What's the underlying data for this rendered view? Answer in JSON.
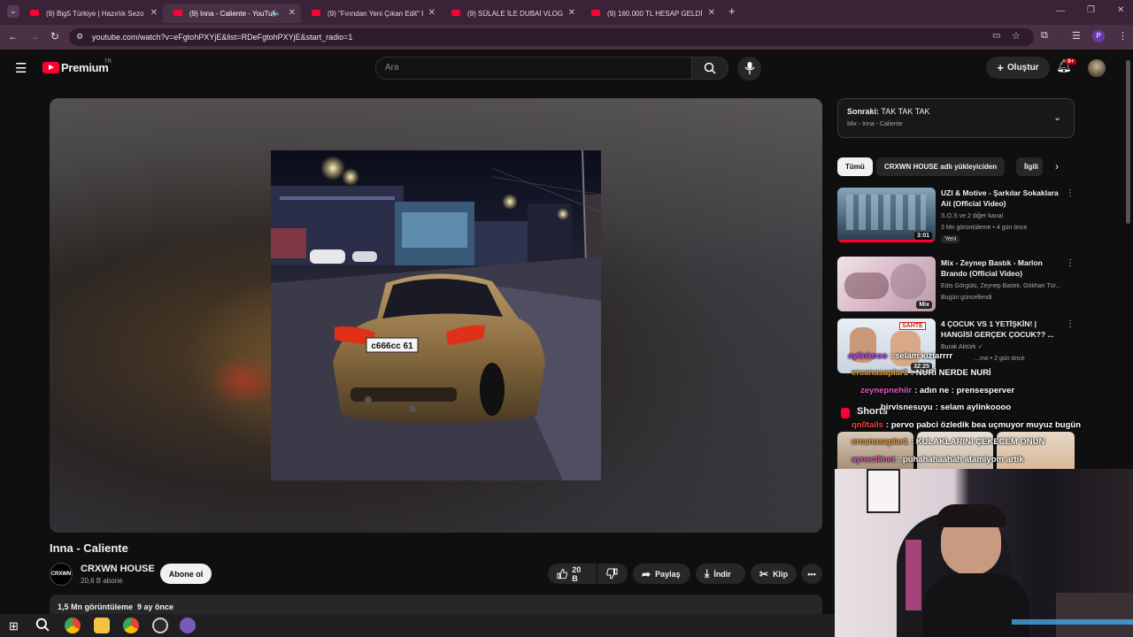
{
  "browser": {
    "tabs": [
      {
        "label": "(9) Big5 Türkiye | Hazırlık Sezon"
      },
      {
        "label": "(9) Inna - Caliente - YouTub"
      },
      {
        "label": "(9) \"Fırından Yeni Çıkan Edit\" Ki"
      },
      {
        "label": "(9) SÜLALE İLE DUBAİ VLOG | 3"
      },
      {
        "label": "(9) 160.000 TL HESAP GELDİ"
      }
    ],
    "new_tab": "+",
    "url": "youtube.com/watch?v=eFgtohPXYjE&list=RDeFgtohPXYjE&start_radio=1",
    "profile_letter": "P"
  },
  "youtube": {
    "logo_text": "Premium",
    "region": "TR",
    "search_placeholder": "Ara",
    "create_label": "Oluştur",
    "notif_count": "9+"
  },
  "video": {
    "title": "Inna - Caliente",
    "plate_text": "с666сс 61",
    "channel_avatar_text": "CRXWN",
    "channel": "CRXWN HOUSE",
    "subscribers": "20,6 B abone",
    "subscribe_label": "Abone ol",
    "likes": "20 B",
    "share_label": "Paylaş",
    "download_label": "İndir",
    "clip_label": "Klip",
    "views": "1,5 Mn görüntüleme",
    "age": "9 ay önce"
  },
  "sidebar": {
    "next_prefix": "Sonraki:",
    "next_title": "TAK TAK TAK",
    "next_sub": "Mix - Inna - Caliente",
    "chips": [
      "Tümü",
      "CRXWN HOUSE adlı yükleyiciden",
      "İlgili"
    ],
    "recs": [
      {
        "title": "UZI & Motive - Şarkılar Sokaklara Ait (Official Video)",
        "channel": "S.O.S ve 2 diğer kanal",
        "meta": "3 Mn görüntüleme • 4 gün önce",
        "badge": "Yeni",
        "duration": "3:01"
      },
      {
        "title": "Mix - Zeynep Bastık - Marlon Brando (Official Video)",
        "channel": "Edis Görgülü, Zeynep Bastık, Gökhan Tür...",
        "meta": "Bugün güncellendi",
        "duration": "Mix"
      },
      {
        "title": "4 ÇOCUK VS 1 YETİŞKİN! | HANGİSİ GERÇEK ÇOCUK?? ...",
        "channel": "Burak Aktürk",
        "meta": "…me • 2 gün önce",
        "duration": "32:25",
        "thumb_label": "SAHTE"
      }
    ],
    "shorts_label": "Shorts"
  },
  "chat": [
    {
      "user": "aylinkooo",
      "text": ": selam kızlarrrr",
      "color": "#c04cff"
    },
    {
      "user": "ercanasaplar1",
      "text": ": NURİ NERDE NURİ",
      "color": "#e8a23a"
    },
    {
      "user": "zeynepnehiir",
      "text": ": adın ne : prensesperver",
      "color": "#e05cc0"
    },
    {
      "user": "birvisnesuyu",
      "text": ": selam aylinkoooo",
      "color": "#ffffff"
    },
    {
      "user": "qn0tails",
      "text": ": pervo pabci özledik bea uçmuyor muyuz bugün",
      "color": "#ff3b3b"
    },
    {
      "user": "ercanasaplar1",
      "text": ": KULAKLARINI ÇEKECEM ONUN",
      "color": "#e8a23a"
    },
    {
      "user": "aynecilinet",
      "text": ": puhahahaahah atamiyom artik",
      "color": "#e05cc0"
    }
  ],
  "colors": {
    "accent_red": "#ff0033",
    "bg": "#0f0f0f",
    "tab_bg": "#3a2336"
  }
}
